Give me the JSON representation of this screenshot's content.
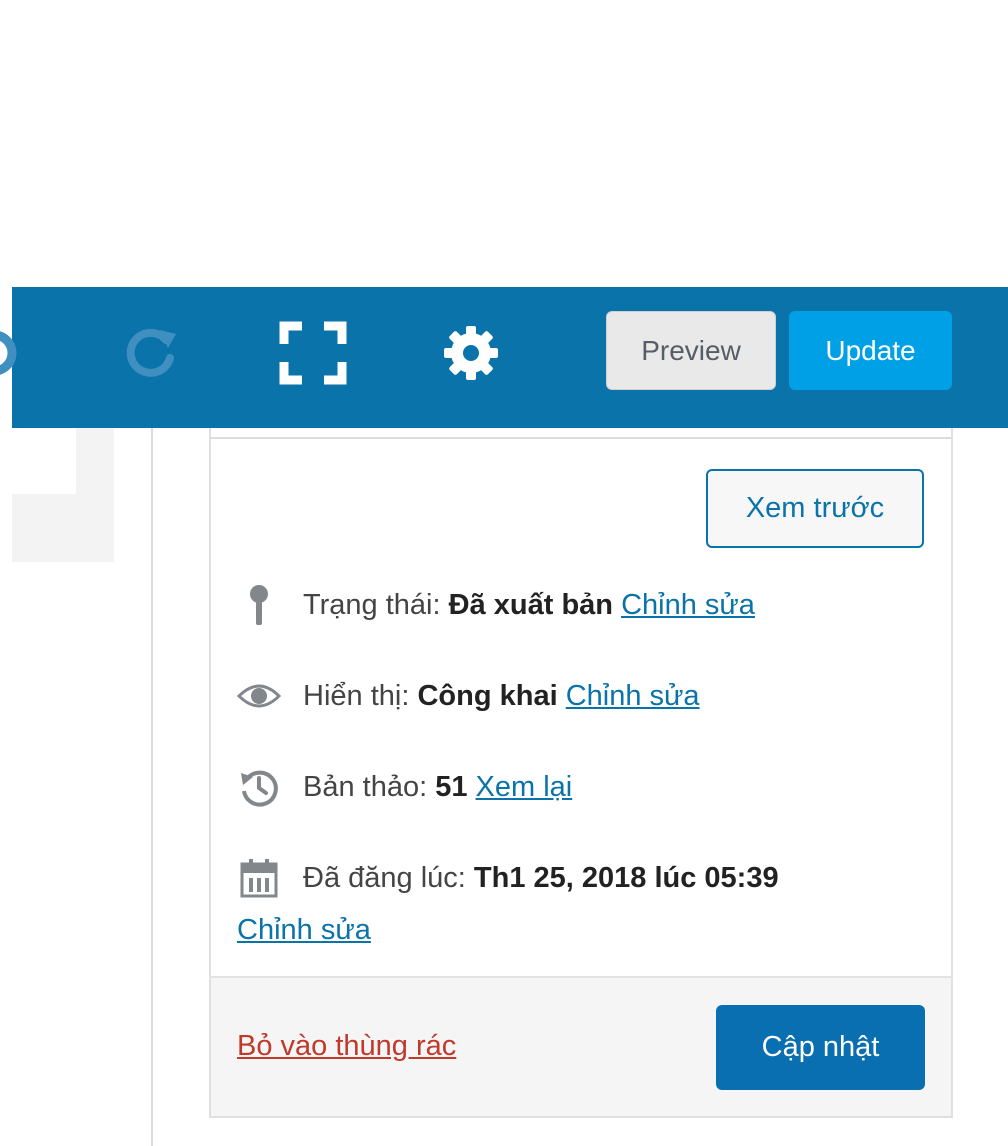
{
  "toolbar": {
    "icons": {
      "undo": "undo-icon",
      "redo": "redo-icon",
      "fullscreen": "fullscreen-icon",
      "settings": "gear-icon"
    },
    "preview_label": "Preview",
    "update_label": "Update",
    "colors": {
      "bar": "#0a73aa",
      "update": "#00a0e6"
    }
  },
  "publish_panel": {
    "preview_button_label": "Xem trước",
    "status": {
      "label": "Trạng thái:",
      "value": "Đã xuất bản",
      "edit_link": "Chỉnh sửa",
      "icon": "pin-icon"
    },
    "visibility": {
      "label": "Hiển thị:",
      "value": "Công khai",
      "edit_link": "Chỉnh sửa",
      "icon": "eye-icon"
    },
    "revisions": {
      "label": "Bản thảo:",
      "value": "51",
      "review_link": "Xem lại",
      "icon": "history-icon"
    },
    "published": {
      "label": "Đã đăng lúc:",
      "value": "Th1 25, 2018 lúc 05:39",
      "edit_link": "Chỉnh sửa",
      "icon": "calendar-icon"
    },
    "trash_link": "Bỏ vào thùng rác",
    "update_button_label": "Cập nhật"
  }
}
